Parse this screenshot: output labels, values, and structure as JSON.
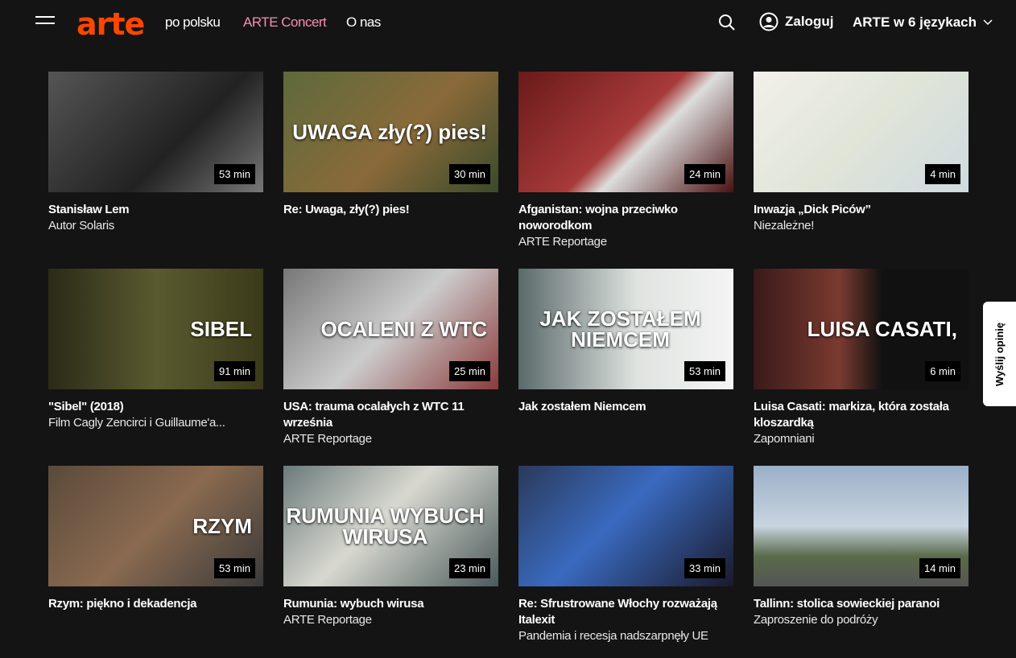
{
  "header": {
    "logo": "arte",
    "nav": [
      {
        "label": "po polsku",
        "color": "#ffffff"
      },
      {
        "label": "ARTE Concert",
        "color": "#f48fb1"
      },
      {
        "label": "O nas",
        "color": "#ffffff"
      }
    ],
    "login": "Zaloguj",
    "language": "ARTE w 6 językach"
  },
  "feedback": "Wyślij opinię",
  "cards": [
    {
      "title": "Stanisław Lem",
      "subtitle": "Autor Solaris",
      "duration": "53 min",
      "overlay": "",
      "bg": "linear-gradient(135deg,#555,#222 60%,#777)"
    },
    {
      "title": "Re: Uwaga, zły(?) pies!",
      "subtitle": "",
      "duration": "30 min",
      "overlay": "UWAGA zły(?) pies!",
      "bg": "linear-gradient(135deg,#5d6a3a,#8a6a3a 55%,#3a4a2a)"
    },
    {
      "title": "Afganistan: wojna przeciwko noworodkom",
      "subtitle": "ARTE Reportage",
      "duration": "24 min",
      "overlay": "",
      "bg": "linear-gradient(135deg,#6a1a1a,#a83a3a 50%,#ddd 60%,#4a1010)"
    },
    {
      "title": "Inwazja „Dick Piców”",
      "subtitle": "Niezależne!",
      "duration": "4 min",
      "overlay": "",
      "bg": "linear-gradient(135deg,#f2f0ea,#e0e5d8 50%,#cfd9e0)"
    },
    {
      "title": "\"Sibel\" (2018)",
      "subtitle": "Film Cagly Zencirci i Guillaume'a...",
      "duration": "91 min",
      "overlay": "SIBEL",
      "bg": "linear-gradient(90deg,#2a2a18,#5a5a30 50%,#3a3a1a)"
    },
    {
      "title": "USA: trauma ocalałych z WTC 11 września",
      "subtitle": "ARTE Reportage",
      "duration": "25 min",
      "overlay": "OCALENI Z WTC",
      "bg": "linear-gradient(135deg,#777,#ccc 50%,#8a3a3a)"
    },
    {
      "title": "Jak zostałem Niemcem",
      "subtitle": "",
      "duration": "53 min",
      "overlay": "JAK ZOSTAŁEM NIEMCEM",
      "bg": "linear-gradient(90deg,#5a6a6a,#dfe3e0 55%,#f4f4f4)"
    },
    {
      "title": "Luisa Casati: markiza, która została kloszardką",
      "subtitle": "Zapomniani",
      "duration": "6 min",
      "overlay": "LUISA CASATI,",
      "bg": "linear-gradient(90deg,#3a1a1a,#7a3a30 40%,#111 60%)"
    },
    {
      "title": "Rzym: piękno i dekadencja",
      "subtitle": "",
      "duration": "53 min",
      "overlay": "RZYM",
      "bg": "linear-gradient(135deg,#5a4a3a,#8a6a50 50%,#3a3a3a)"
    },
    {
      "title": "Rumunia: wybuch wirusa",
      "subtitle": "ARTE Reportage",
      "duration": "23 min",
      "overlay": "RUMUNIA WYBUCH WIRUSA",
      "bg": "linear-gradient(135deg,#6a7a7a,#d8d8d0 45%,#4a5a5a)"
    },
    {
      "title": "Re: Sfrustrowane Włochy rozważają Italexit",
      "subtitle": "Pandemia i recesja nadszarpnęły UE",
      "duration": "33 min",
      "overlay": "",
      "bg": "linear-gradient(135deg,#2a3a5a,#3a6ac0 45%,#1a1a2a)"
    },
    {
      "title": "Tallinn: stolica sowieckiej paranoi",
      "subtitle": "Zaproszenie do podróży",
      "duration": "14 min",
      "overlay": "",
      "bg": "linear-gradient(180deg,#9ab0c8,#c8d4e0 50%,#5a6a4a 75%,#555)"
    }
  ]
}
